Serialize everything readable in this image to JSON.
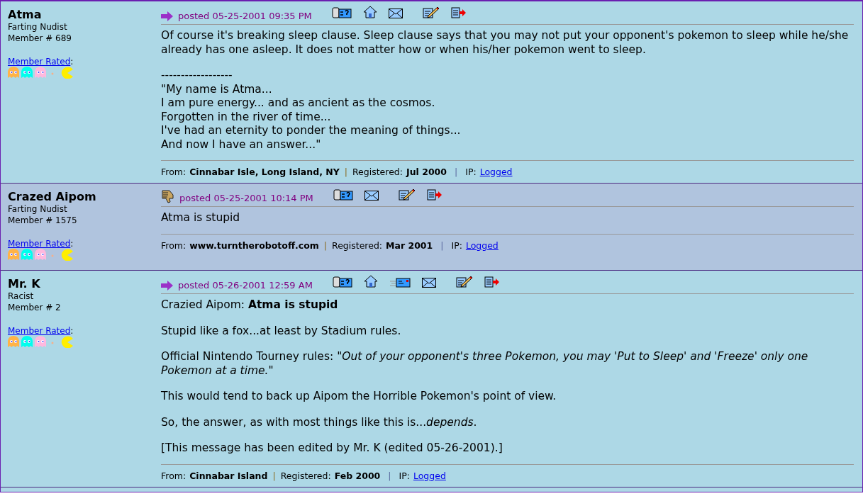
{
  "posts": [
    {
      "author": "Atma",
      "title": "Farting Nudist",
      "member_no": "Member # 689",
      "rated_link": "Member Rated",
      "rated_colon": ":",
      "post_icon": {
        "kind": "arrow"
      },
      "posted": "posted 05-25-2001 09:35 PM",
      "actions": [
        {
          "kind": "profile"
        },
        {
          "kind": "home"
        },
        {
          "kind": "email"
        },
        {
          "kind": "edit"
        },
        {
          "kind": "quote"
        }
      ],
      "body": [
        "Of course it's breaking sleep clause. Sleep clause says that you may not put your opponent's pokemon to sleep while he/she already has one asleep. It does not matter how or when his/her pokemon went to sleep.",
        "------------------\n\"My name is Atma...\nI am pure energy... and as ancient as the cosmos.\nForgotten in the river of time...\nI've had an eternity to ponder the meaning of things...\nAnd now I have an answer...\""
      ],
      "footer": {
        "from_label": "From:",
        "from": "Cinnabar Isle, Long Island, NY",
        "sep1": "|",
        "registered_label": "Registered:",
        "registered": "Jul 2000",
        "sep2": "|",
        "ip_label": "IP:",
        "ip_link": "Logged"
      }
    },
    {
      "author": "Crazed Aipom",
      "title": "Farting Nudist",
      "member_no": "Member # 1575",
      "rated_link": "Member Rated",
      "rated_colon": ":",
      "post_icon": {
        "kind": "thumbs-down"
      },
      "posted": "posted 05-25-2001 10:14 PM",
      "actions": [
        {
          "kind": "profile"
        },
        {
          "kind": "email"
        },
        {
          "kind": "edit"
        },
        {
          "kind": "quote"
        }
      ],
      "body": [
        "Atma is stupid"
      ],
      "footer": {
        "from_label": "From:",
        "from": "www.turntherobotoff.com",
        "sep1": "|",
        "registered_label": "Registered:",
        "registered": "Mar 2001",
        "sep2": "|",
        "ip_label": "IP:",
        "ip_link": "Logged"
      }
    },
    {
      "author": "Mr. K",
      "title": "Racist",
      "member_no": "Member # 2",
      "rated_link": "Member Rated",
      "rated_colon": ":",
      "post_icon": {
        "kind": "arrow"
      },
      "posted": "posted 05-26-2001 12:59 AM",
      "actions": [
        {
          "kind": "profile"
        },
        {
          "kind": "home"
        },
        {
          "kind": "message"
        },
        {
          "kind": "email"
        },
        {
          "kind": "edit"
        },
        {
          "kind": "quote"
        }
      ],
      "body": [
        "Crazied Aipom: **Atma is stupid**",
        "Stupid like a fox...at least by Stadium rules.",
        "Official Nintendo Tourney rules: *\"Out of your opponent's three Pokemon, you may 'Put to Sleep' and 'Freeze' only one Pokemon at a time.\"*",
        "This would tend to back up Aipom the Horrible Pokemon's point of view.",
        "So, the answer, as with most things like this is...*depends*.",
        "[This message has been edited by Mr. K (edited 05-26-2001).]"
      ],
      "footer": {
        "from_label": "From:",
        "from": "Cinnabar Island",
        "sep1": "|",
        "registered_label": "Registered:",
        "registered": "Feb 2000",
        "sep2": "|",
        "ip_label": "IP:",
        "ip_link": "Logged"
      }
    }
  ]
}
